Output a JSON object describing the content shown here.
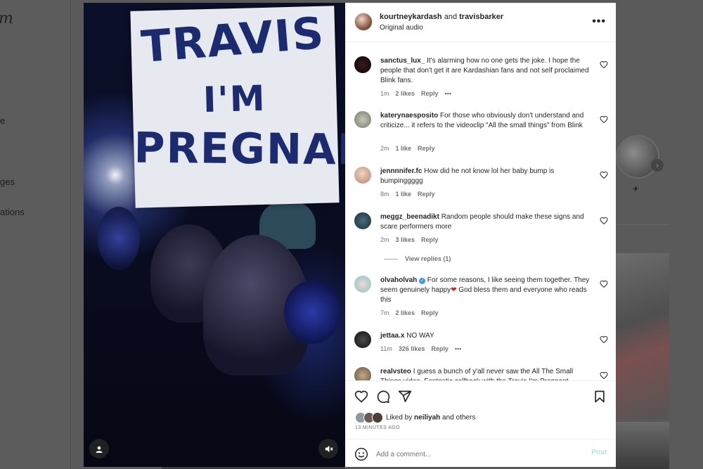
{
  "background": {
    "logo_text": "m",
    "nav_items": [
      {
        "label": "e"
      },
      {
        "label": "ges"
      },
      {
        "label": "ations"
      }
    ],
    "suggested_name": "✈"
  },
  "post": {
    "authors": "kourtneykardash",
    "connector": " and ",
    "coauthor": "travisbarker",
    "audio": "Original audio",
    "media_sign_lines": [
      "TRAVIS",
      "I'M",
      "PREGNANT"
    ]
  },
  "comments": [
    {
      "user": "sanctus_lux_",
      "text": " It's alarming how no one gets the joke. I hope the people that don't get it are Kardashian fans and not self proclaimed Blink fans.",
      "time": "1m",
      "likes": "2 likes",
      "reply": "Reply",
      "more": "•••"
    },
    {
      "user": "katerynaesposito",
      "text": " For those who obviously don't understand and criticize... it refers to the videoclip \"All the small things\" from Blink",
      "time": "2m",
      "likes": "1 like",
      "reply": "Reply"
    },
    {
      "user": "jennnnifer.fc",
      "text": " How did he not know lol her baby bump is bumpinggggg",
      "time": "8m",
      "likes": "1 like",
      "reply": "Reply"
    },
    {
      "user": "meggz_beenadikt",
      "text": " Random people should make these signs and scare performers more",
      "time": "2m",
      "likes": "3 likes",
      "reply": "Reply",
      "view_replies": "View replies (1)"
    },
    {
      "user": "olvaholvah",
      "text": " For some reasons, I like seeing them together. They seem genuinely happy",
      "text2": " God bless them and everyone who reads this",
      "time": "7m",
      "likes": "2 likes",
      "reply": "Reply"
    },
    {
      "user": "jettaa.x",
      "text": " NO WAY",
      "time": "11m",
      "likes": "326 likes",
      "reply": "Reply",
      "more": "•••"
    },
    {
      "user": "realvsteo",
      "text": " I guess a bunch of y'all never saw the All The Small Things video. Fantastic callback with the Travis I'm Pregnant"
    }
  ],
  "likes": {
    "prefix": "Liked by ",
    "user": "neiliyah",
    "suffix": " and others"
  },
  "timestamp": "13 MINUTES AGO",
  "add_comment": {
    "placeholder": "Add a comment...",
    "post_label": "Post"
  },
  "colors": {
    "link_blue": "#3897f0",
    "post_disabled": "#b2dffc",
    "heart_red": "#e0201b"
  },
  "icons": [
    "more-icon",
    "heart-icon",
    "comment-icon",
    "share-icon",
    "save-icon",
    "emoji-icon",
    "user-tag-icon",
    "mute-icon",
    "verified-icon"
  ]
}
